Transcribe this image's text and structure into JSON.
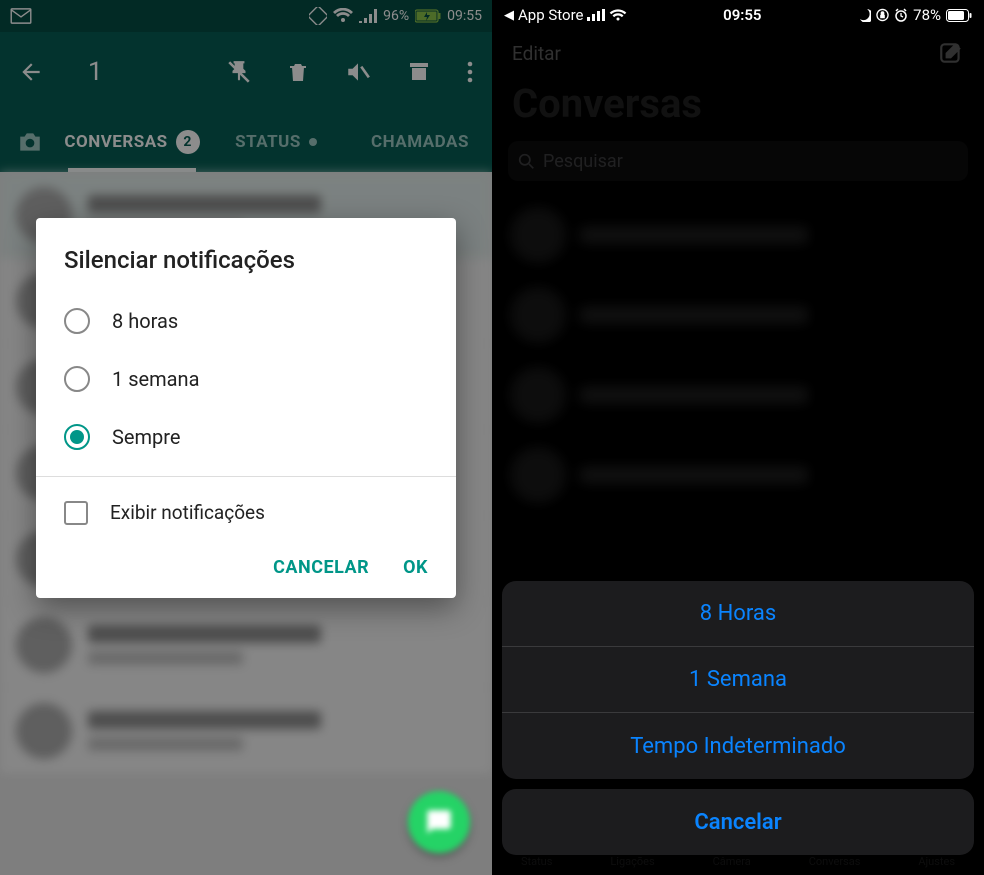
{
  "android": {
    "statusbar": {
      "battery": "96%",
      "time": "09:55"
    },
    "actionbar": {
      "selected_count": "1"
    },
    "tabs": {
      "conversas": "CONVERSAS",
      "conversas_badge": "2",
      "status": "STATUS",
      "chamadas": "CHAMADAS"
    },
    "dialog": {
      "title": "Silenciar notificações",
      "opt1": "8 horas",
      "opt2": "1 semana",
      "opt3": "Sempre",
      "show_notif": "Exibir notificações",
      "cancel": "CANCELAR",
      "ok": "OK"
    }
  },
  "ios": {
    "statusbar": {
      "back_app": "App Store",
      "time": "09:55",
      "battery": "78%"
    },
    "nav": {
      "edit": "Editar"
    },
    "title": "Conversas",
    "search_placeholder": "Pesquisar",
    "sheet": {
      "opt1": "8 Horas",
      "opt2": "1 Semana",
      "opt3": "Tempo Indeterminado",
      "cancel": "Cancelar"
    },
    "tabbar": {
      "t1": "Status",
      "t2": "Ligações",
      "t3": "Câmera",
      "t4": "Conversas",
      "t5": "Ajustes"
    }
  }
}
